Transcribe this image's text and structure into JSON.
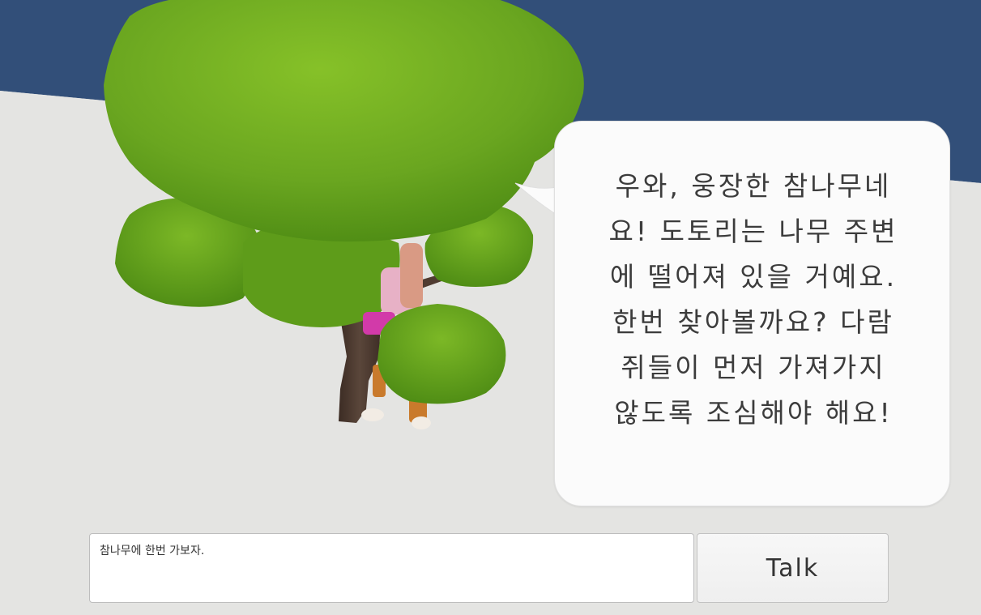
{
  "dialogue": {
    "npc_text": "우와, 웅장한 참나무네\n요! 도토리는 나무 주변\n에 떨어져 있을 거예요.\n한번 찾아볼까요? 다람\n쥐들이 먼저 가져가지\n않도록 조심해야 해요!"
  },
  "chat": {
    "input_value": "참나무에 한번 가보자.",
    "talk_label": "Talk"
  },
  "colors": {
    "sky": "#324f79",
    "ground": "#e4e4e2",
    "foliage": "#6faa22",
    "foliage_dark": "#4e8a14",
    "trunk": "#4f3b31",
    "bubble": "#fbfbfb"
  }
}
